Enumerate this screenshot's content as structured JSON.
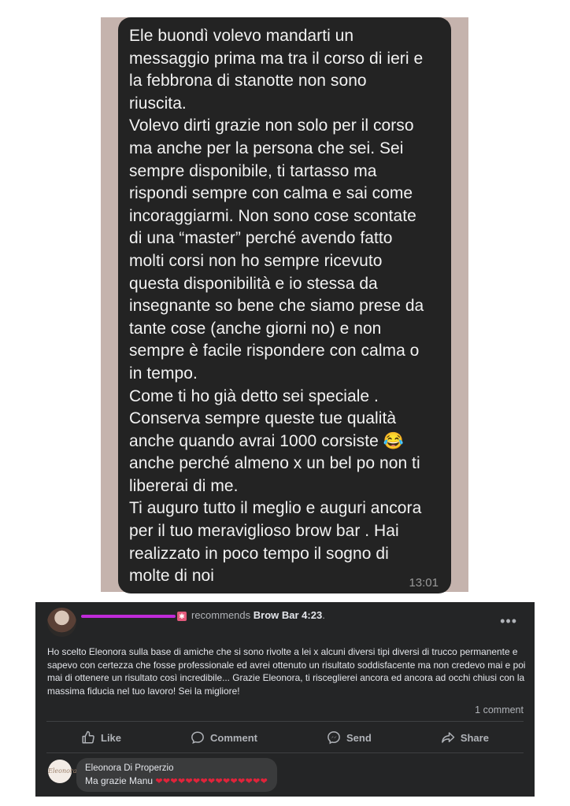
{
  "chat": {
    "message": "Ele buondì volevo mandarti un\nmessaggio prima ma tra il corso di ieri e\nla febbrona di stanotte non sono\nriuscita.\nVolevo dirti grazie non solo per il corso\nma anche per la persona che sei. Sei\nsempre disponibile, ti tartasso ma\nrispondi sempre con calma e sai come\nincoraggiarmi. Non sono cose scontate\ndi una “master” perché avendo fatto\nmolti corsi non ho sempre ricevuto\nquesta disponibilità e io stessa da\ninsegnante so bene che siamo prese da\ntante cose (anche giorni no) e non\nsempre è facile rispondere con calma o\nin tempo.\nCome ti ho già detto sei speciale .\nConserva sempre queste tue qualità\nanche quando avrai 1000 corsiste 😂\nanche perché almeno x un bel po non ti\nlibererai di me.\nTi auguro tutto il meglio e auguri ancora\nper il tuo meraviglioso brow bar . Hai\nrealizzato in poco tempo il sogno di\nmolte di noi",
    "time": "13:01"
  },
  "review": {
    "recommends_text": "recommends",
    "page_name": "Brow Bar 4:23",
    "period": ".",
    "more_icon": "more-dots-icon",
    "body": "Ho scelto Eleonora sulla base di amiche che si sono rivolte a lei x alcuni diversi tipi diversi di trucco permanente e sapevo con certezza che fosse professionale ed avrei ottenuto un risultato soddisfacente ma non credevo mai e poi mai di ottenere un risultato così incredibile... Grazie Eleonora, ti risceglierei ancora ed ancora ad occhi chiusi con la massima fiducia nel tuo lavoro! Sei la migliore!",
    "comment_count": "1 comment",
    "actions": {
      "like": "Like",
      "comment": "Comment",
      "send": "Send",
      "share": "Share"
    },
    "reply": {
      "name": "Eleonora Di Properzio",
      "text": "Ma grazie Manu",
      "hearts": "❤❤❤❤❤❤❤❤❤❤❤❤❤❤❤"
    }
  }
}
